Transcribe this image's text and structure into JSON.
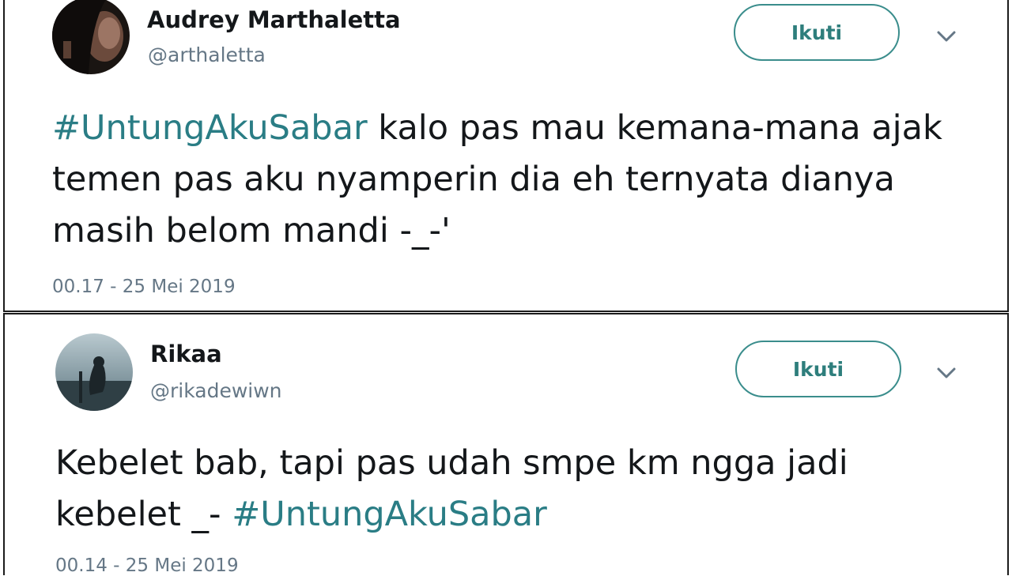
{
  "tweets": [
    {
      "name": "Audrey Marthaletta",
      "handle": "@arthaletta",
      "follow_label": "Ikuti",
      "more_icon": "chevron-down-icon",
      "hashtag": "#UntungAkuSabar",
      "text_after_hashtag": " kalo pas mau kemana-mana ajak temen pas aku nyamperin dia eh ternyata dianya masih belom mandi -_-'",
      "timestamp": "00.17 - 25 Mei 2019"
    },
    {
      "name": "Rikaa",
      "handle": "@rikadewiwn",
      "follow_label": "Ikuti",
      "more_icon": "chevron-down-icon",
      "text_before_hashtag": "Kebelet bab, tapi pas udah smpe km ngga jadi kebelet _- ",
      "hashtag": "#UntungAkuSabar",
      "timestamp": "00.14 - 25 Mei 2019"
    }
  ],
  "colors": {
    "hashtag": "#2a7d85",
    "follow_button": "#2e7e7c",
    "secondary_text": "#657786",
    "primary_text": "#14171a"
  }
}
